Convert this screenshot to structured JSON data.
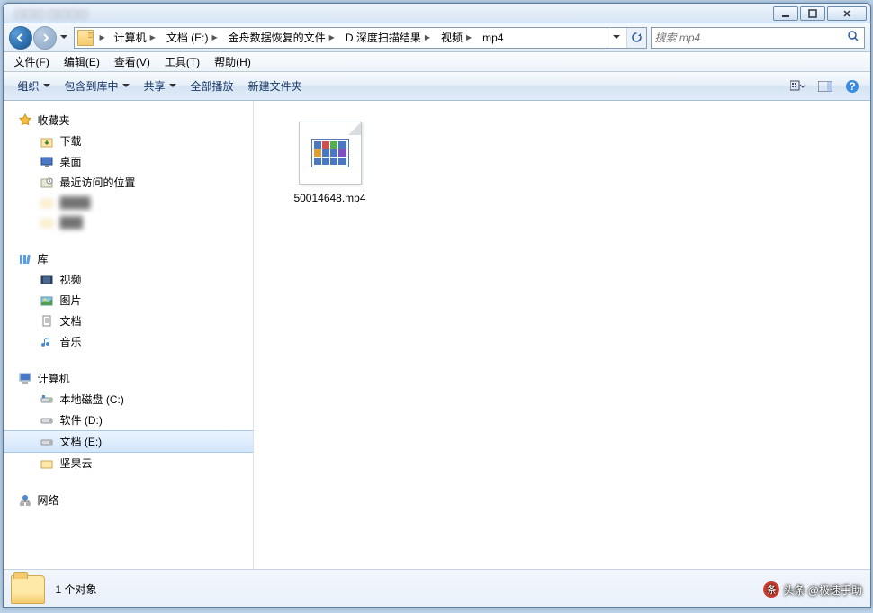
{
  "titlebar": {
    "blurred_text": "文档 (E:)"
  },
  "breadcrumb": {
    "items": [
      "计算机",
      "文档 (E:)",
      "金舟数据恢复的文件",
      "D 深度扫描结果",
      "视频",
      "mp4"
    ]
  },
  "search": {
    "placeholder": "搜索 mp4"
  },
  "menu": {
    "file": "文件(F)",
    "edit": "编辑(E)",
    "view": "查看(V)",
    "tools": "工具(T)",
    "help": "帮助(H)"
  },
  "toolbar": {
    "organize": "组织",
    "include": "包含到库中",
    "share": "共享",
    "play_all": "全部播放",
    "new_folder": "新建文件夹"
  },
  "sidebar": {
    "favorites": {
      "label": "收藏夹",
      "items": [
        {
          "label": "下载",
          "icon": "download"
        },
        {
          "label": "桌面",
          "icon": "desktop"
        },
        {
          "label": "最近访问的位置",
          "icon": "recent"
        },
        {
          "label": "████",
          "icon": "folder",
          "blur": true
        },
        {
          "label": "███",
          "icon": "folder",
          "blur": true
        }
      ]
    },
    "libraries": {
      "label": "库",
      "items": [
        {
          "label": "视频",
          "icon": "video"
        },
        {
          "label": "图片",
          "icon": "pictures"
        },
        {
          "label": "文档",
          "icon": "documents"
        },
        {
          "label": "音乐",
          "icon": "music"
        }
      ]
    },
    "computer": {
      "label": "计算机",
      "items": [
        {
          "label": "本地磁盘 (C:)",
          "icon": "drive-c"
        },
        {
          "label": "软件 (D:)",
          "icon": "drive"
        },
        {
          "label": "文档 (E:)",
          "icon": "drive",
          "selected": true
        },
        {
          "label": "坚果云",
          "icon": "folder"
        }
      ]
    },
    "network": {
      "label": "网络"
    }
  },
  "files": [
    {
      "name": "50014648.mp4"
    }
  ],
  "status": {
    "text": "1 个对象"
  },
  "watermark": {
    "text": "头条 @极速手助"
  }
}
